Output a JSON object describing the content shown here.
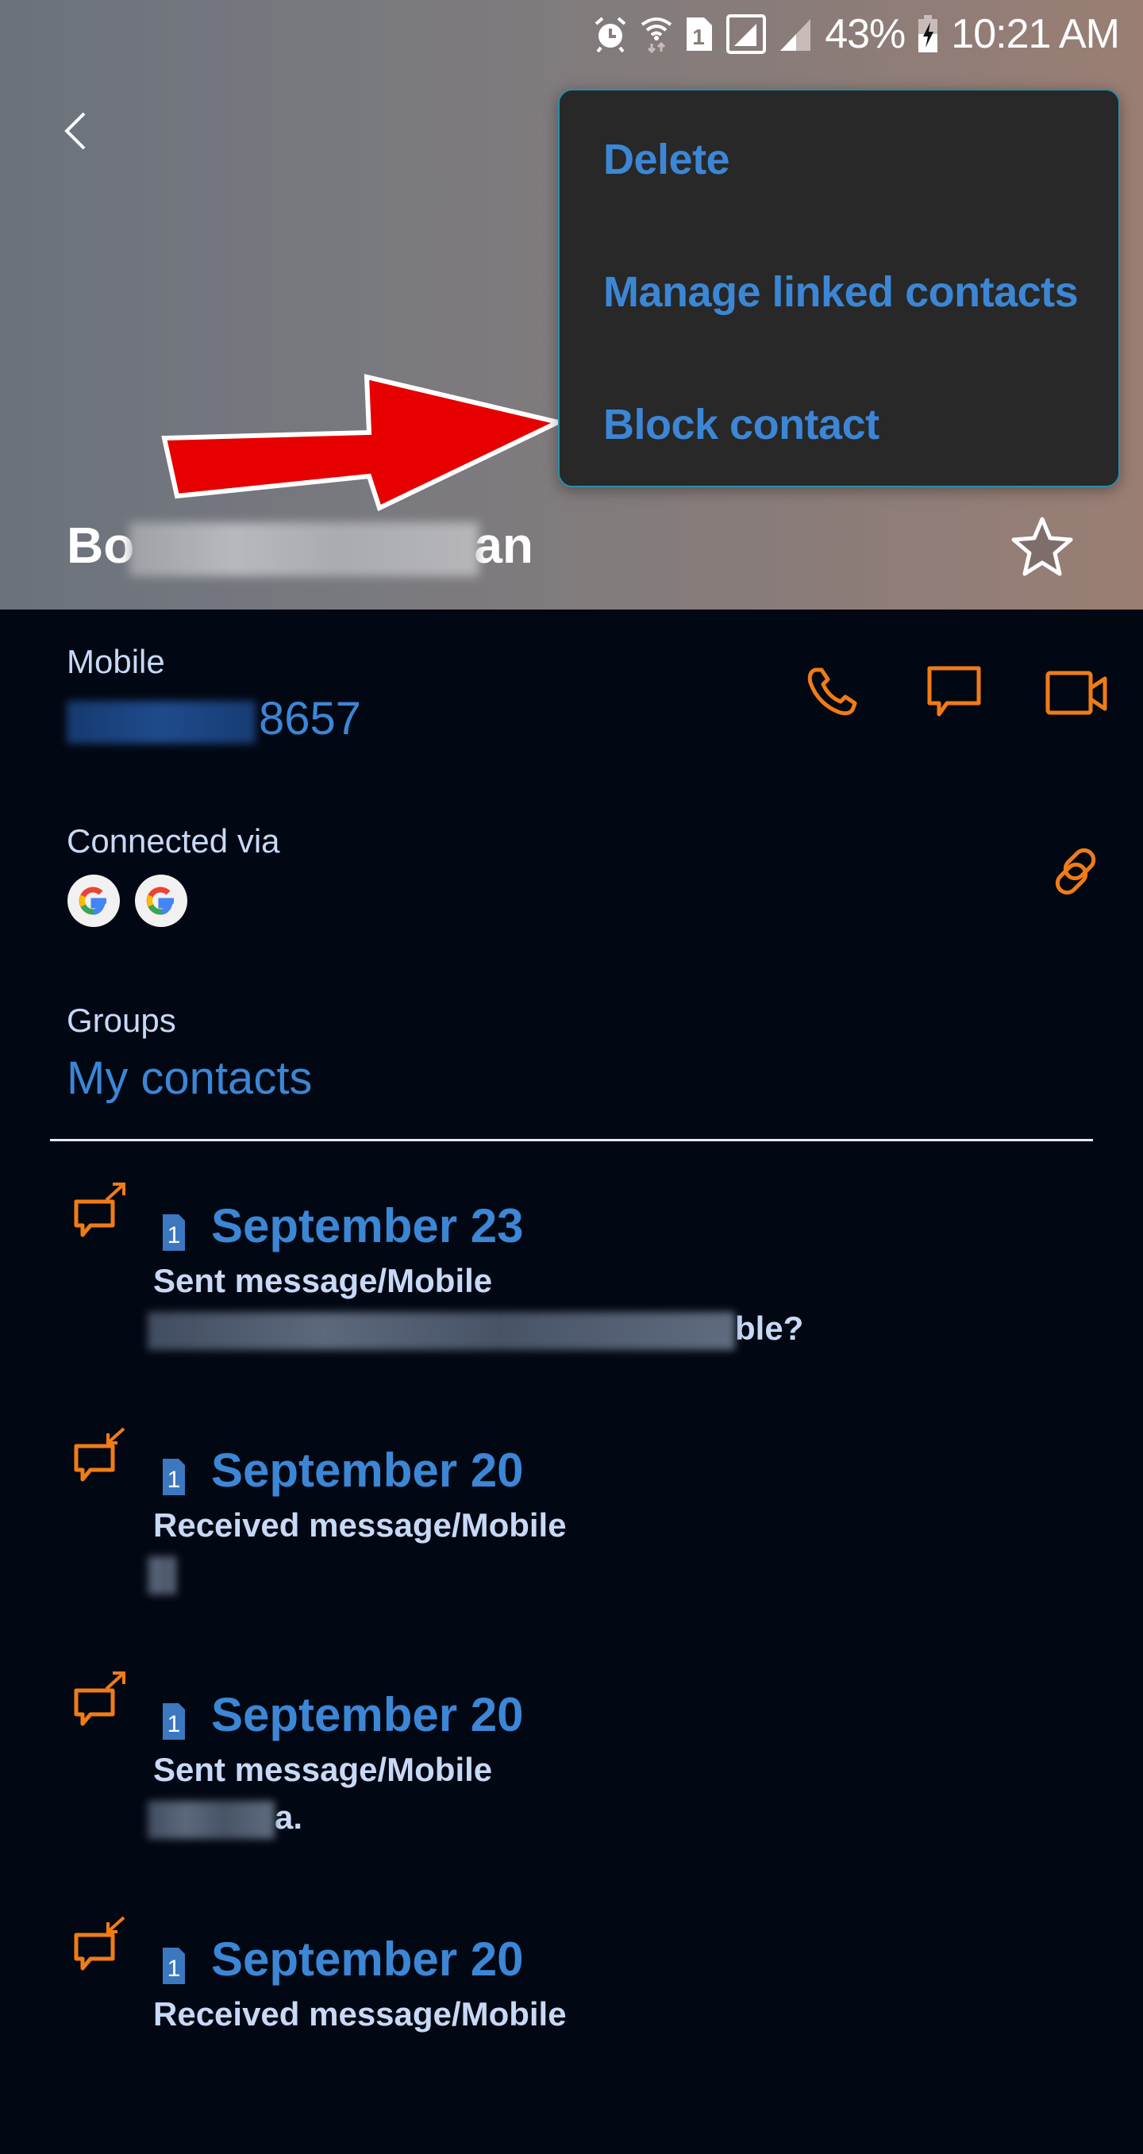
{
  "status_bar": {
    "icons": [
      "alarm-icon",
      "wifi-icon",
      "sim-1-icon",
      "signal-icon",
      "signal-secondary-icon",
      "battery-charging-icon"
    ],
    "sim_label": "1",
    "battery": "43%",
    "time": "10:21 AM"
  },
  "header": {
    "back_icon": "chevron-left-icon",
    "contact_name_prefix": "Bo",
    "contact_name_suffix": "an",
    "contact_name_redacted": true,
    "favorite_icon": "star-outline-icon"
  },
  "overflow_menu": {
    "items": [
      {
        "label": "Delete"
      },
      {
        "label": "Manage linked contacts"
      },
      {
        "label": "Block contact"
      }
    ]
  },
  "annotation": {
    "type": "red-arrow",
    "points_to": "Block contact",
    "color": "#e60000"
  },
  "details": {
    "mobile_label": "Mobile",
    "mobile_number_visible_suffix": "8657",
    "mobile_number_redacted": true,
    "actions": [
      {
        "name": "call",
        "icon": "phone-icon"
      },
      {
        "name": "message",
        "icon": "message-icon"
      },
      {
        "name": "video-call",
        "icon": "video-camera-icon"
      }
    ],
    "connected_via_label": "Connected via",
    "connected_accounts": [
      "Google",
      "Google"
    ],
    "link_icon": "link-icon",
    "groups_label": "Groups",
    "groups_value": "My contacts"
  },
  "history": [
    {
      "direction": "sent",
      "icon": "message-outgoing-icon",
      "sim": "1",
      "date": "September 23",
      "type": "Sent message/Mobile",
      "snippet_visible": "ble?",
      "snippet_redacted": true
    },
    {
      "direction": "received",
      "icon": "message-incoming-icon",
      "sim": "1",
      "date": "September 20",
      "type": "Received message/Mobile",
      "snippet_visible": "",
      "snippet_redacted": true
    },
    {
      "direction": "sent",
      "icon": "message-outgoing-icon",
      "sim": "1",
      "date": "September 20",
      "type": "Sent message/Mobile",
      "snippet_visible": "a.",
      "snippet_redacted": true
    },
    {
      "direction": "received",
      "icon": "message-incoming-icon",
      "sim": "1",
      "date": "September 20",
      "type": "Received message/Mobile",
      "snippet_visible": "",
      "snippet_redacted": true
    }
  ],
  "colors": {
    "accent_blue": "#3c86d6",
    "action_orange": "#f07c16",
    "background": "#020813",
    "menu_background": "#282828",
    "label_text": "#c7d9f5"
  }
}
